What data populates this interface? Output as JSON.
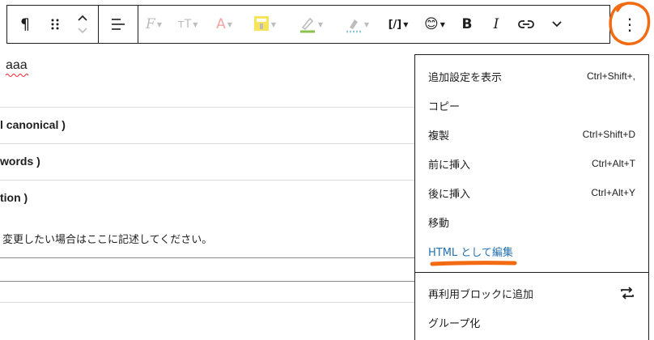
{
  "toolbar": {
    "paragraph_icon": "paragraph-icon",
    "drag_icon": "drag-handle-icon",
    "move_icon": "chevron-up-down-icon",
    "align_icon": "align-left-icon",
    "font_icon": "font-family-icon",
    "size_icon": "font-size-icon",
    "text_color_label": "A",
    "highlight_icon": "highlighter-icon",
    "underline_icon": "pen-underline-icon",
    "pen_icon": "pen-dotted-icon",
    "code_label": "[/]",
    "emoji": "😊",
    "bold_label": "B",
    "italic_label": "I",
    "link_icon": "link-icon",
    "more_icon": "chevron-down-icon",
    "options_label": "⋮",
    "colors": {
      "accent_text": "#f5a3a3",
      "highlight": "#f8e45a",
      "annotation": "#f26b12"
    }
  },
  "editor": {
    "text_aaa": "aaa",
    "heading_canonical": "l canonical )",
    "heading_keywords": "words )",
    "heading_description": "tion )",
    "note": "変更したい場合はここに記述してください。"
  },
  "menu": {
    "items": [
      {
        "label": "追加設定を表示",
        "shortcut": "Ctrl+Shift+,"
      },
      {
        "label": "コピー",
        "shortcut": ""
      },
      {
        "label": "複製",
        "shortcut": "Ctrl+Shift+D"
      },
      {
        "label": "前に挿入",
        "shortcut": "Ctrl+Alt+T"
      },
      {
        "label": "後に挿入",
        "shortcut": "Ctrl+Alt+Y"
      },
      {
        "label": "移動",
        "shortcut": ""
      },
      {
        "label": "HTML として編集",
        "shortcut": ""
      }
    ],
    "secondary": [
      {
        "label": "再利用ブロックに追加",
        "icon": "reuse-icon"
      },
      {
        "label": "グループ化",
        "icon": ""
      }
    ]
  }
}
